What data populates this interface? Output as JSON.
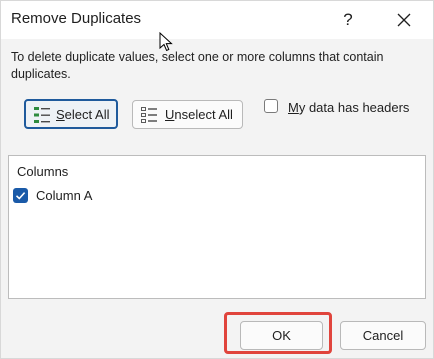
{
  "window": {
    "title": "Remove Duplicates",
    "help_label": "?"
  },
  "instructions": "To delete duplicate values, select one or more columns that contain duplicates.",
  "select_all": {
    "hotkey": "S",
    "rest": "elect All"
  },
  "unselect_all": {
    "hotkey": "U",
    "rest": "nselect All"
  },
  "headers_option": {
    "hotkey": "M",
    "rest": "y data has headers",
    "checked": false
  },
  "columns": {
    "header": "Columns",
    "items": [
      {
        "label": "Column A",
        "checked": true
      }
    ]
  },
  "footer": {
    "ok_label": "OK",
    "cancel_label": "Cancel"
  },
  "colors": {
    "accent": "#1a5aa8",
    "highlight": "#e0443c",
    "dialog_bg": "#f3f3f3"
  }
}
